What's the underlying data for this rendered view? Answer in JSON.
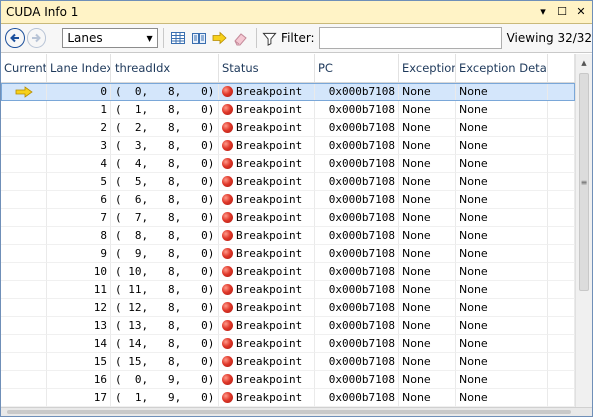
{
  "window": {
    "title": "CUDA Info 1"
  },
  "title_buttons": {
    "dropdown": "▾",
    "maximize": "☐",
    "close": "✕"
  },
  "toolbar": {
    "lanes_value": "Lanes",
    "filter_label": "Filter:",
    "filter_value": "",
    "viewing": "Viewing 32/32"
  },
  "colors": {
    "title_bar": "#fff3c6",
    "selection": "#d4e6fb",
    "breakpoint_dot": "#e0382a",
    "header_text": "#1e395b"
  },
  "columns": [
    "Current",
    "Lane Index",
    "threadIdx",
    "Status",
    "PC",
    "Exception",
    "Exception Details"
  ],
  "rows": [
    {
      "current": true,
      "lane": "0",
      "tid": "(  0,   8,   0)",
      "status": "Breakpoint",
      "pc": "0x000b7108",
      "exc": "None",
      "excd": "None"
    },
    {
      "current": false,
      "lane": "1",
      "tid": "(  1,   8,   0)",
      "status": "Breakpoint",
      "pc": "0x000b7108",
      "exc": "None",
      "excd": "None"
    },
    {
      "current": false,
      "lane": "2",
      "tid": "(  2,   8,   0)",
      "status": "Breakpoint",
      "pc": "0x000b7108",
      "exc": "None",
      "excd": "None"
    },
    {
      "current": false,
      "lane": "3",
      "tid": "(  3,   8,   0)",
      "status": "Breakpoint",
      "pc": "0x000b7108",
      "exc": "None",
      "excd": "None"
    },
    {
      "current": false,
      "lane": "4",
      "tid": "(  4,   8,   0)",
      "status": "Breakpoint",
      "pc": "0x000b7108",
      "exc": "None",
      "excd": "None"
    },
    {
      "current": false,
      "lane": "5",
      "tid": "(  5,   8,   0)",
      "status": "Breakpoint",
      "pc": "0x000b7108",
      "exc": "None",
      "excd": "None"
    },
    {
      "current": false,
      "lane": "6",
      "tid": "(  6,   8,   0)",
      "status": "Breakpoint",
      "pc": "0x000b7108",
      "exc": "None",
      "excd": "None"
    },
    {
      "current": false,
      "lane": "7",
      "tid": "(  7,   8,   0)",
      "status": "Breakpoint",
      "pc": "0x000b7108",
      "exc": "None",
      "excd": "None"
    },
    {
      "current": false,
      "lane": "8",
      "tid": "(  8,   8,   0)",
      "status": "Breakpoint",
      "pc": "0x000b7108",
      "exc": "None",
      "excd": "None"
    },
    {
      "current": false,
      "lane": "9",
      "tid": "(  9,   8,   0)",
      "status": "Breakpoint",
      "pc": "0x000b7108",
      "exc": "None",
      "excd": "None"
    },
    {
      "current": false,
      "lane": "10",
      "tid": "( 10,   8,   0)",
      "status": "Breakpoint",
      "pc": "0x000b7108",
      "exc": "None",
      "excd": "None"
    },
    {
      "current": false,
      "lane": "11",
      "tid": "( 11,   8,   0)",
      "status": "Breakpoint",
      "pc": "0x000b7108",
      "exc": "None",
      "excd": "None"
    },
    {
      "current": false,
      "lane": "12",
      "tid": "( 12,   8,   0)",
      "status": "Breakpoint",
      "pc": "0x000b7108",
      "exc": "None",
      "excd": "None"
    },
    {
      "current": false,
      "lane": "13",
      "tid": "( 13,   8,   0)",
      "status": "Breakpoint",
      "pc": "0x000b7108",
      "exc": "None",
      "excd": "None"
    },
    {
      "current": false,
      "lane": "14",
      "tid": "( 14,   8,   0)",
      "status": "Breakpoint",
      "pc": "0x000b7108",
      "exc": "None",
      "excd": "None"
    },
    {
      "current": false,
      "lane": "15",
      "tid": "( 15,   8,   0)",
      "status": "Breakpoint",
      "pc": "0x000b7108",
      "exc": "None",
      "excd": "None"
    },
    {
      "current": false,
      "lane": "16",
      "tid": "(  0,   9,   0)",
      "status": "Breakpoint",
      "pc": "0x000b7108",
      "exc": "None",
      "excd": "None"
    },
    {
      "current": false,
      "lane": "17",
      "tid": "(  1,   9,   0)",
      "status": "Breakpoint",
      "pc": "0x000b7108",
      "exc": "None",
      "excd": "None"
    }
  ]
}
